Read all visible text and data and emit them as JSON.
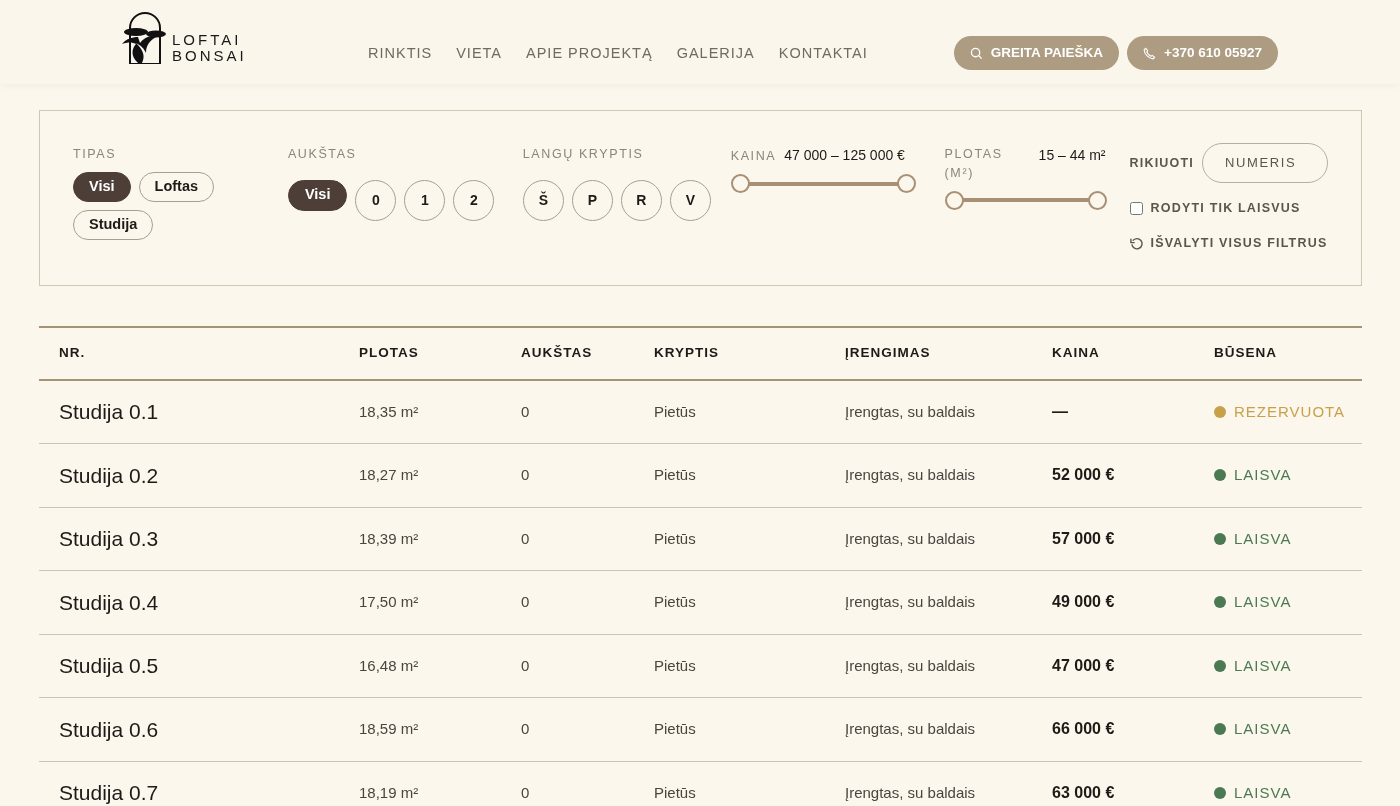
{
  "brand": {
    "line1": "LOFTAI",
    "line2": "BONSAI"
  },
  "nav": [
    "RINKTIS",
    "VIETA",
    "APIE PROJEKTĄ",
    "GALERIJA",
    "KONTAKTAI"
  ],
  "header_buttons": [
    {
      "kind": "search",
      "label": "GREITA PAIEŠKA"
    },
    {
      "kind": "phone",
      "label": "+370 610 05927"
    }
  ],
  "filters": {
    "type": {
      "label": "TIPAS",
      "options": [
        {
          "label": "Visi",
          "selected": true
        },
        {
          "label": "Loftas",
          "selected": false
        },
        {
          "label": "Studija",
          "selected": false
        }
      ]
    },
    "floor": {
      "label": "AUKŠTAS",
      "options": [
        {
          "label": "Visi",
          "selected": true
        },
        {
          "label": "0",
          "selected": false
        },
        {
          "label": "1",
          "selected": false
        },
        {
          "label": "2",
          "selected": false
        }
      ]
    },
    "direction": {
      "label": "LANGŲ KRYPTIS",
      "options": [
        {
          "label": "Š",
          "selected": false
        },
        {
          "label": "P",
          "selected": false
        },
        {
          "label": "R",
          "selected": false
        },
        {
          "label": "V",
          "selected": false
        }
      ]
    },
    "price": {
      "label": "KAINA",
      "reading": "47 000 – 125 000 €",
      "thumbs": [
        {
          "level": 0
        },
        {
          "level": 1
        }
      ]
    },
    "area": {
      "label": "PLOTAS (M²)",
      "reading": "15 – 44 m²",
      "thumbs": [
        {
          "level": 0
        },
        {
          "level": 1
        }
      ]
    },
    "sort": {
      "label": "RIKIUOTI",
      "value": "NUMERIS"
    },
    "only_free": {
      "label": "RODYTI TIK LAISVUS",
      "checked": false
    },
    "clear": {
      "label": "IŠVALYTI VISUS FILTRUS"
    }
  },
  "table": {
    "columns": [
      "NR.",
      "PLOTAS",
      "AUKŠTAS",
      "KRYPTIS",
      "ĮRENGIMAS",
      "KAINA",
      "BŪSENA"
    ],
    "rows": [
      {
        "name": "Studija 0.1",
        "area": "18,35 m²",
        "floor": "0",
        "direction": "Pietūs",
        "fit_out": "Įrengtas, su baldais",
        "price": "—",
        "status": "REZERVUOTA",
        "color": "#c9a04a"
      },
      {
        "name": "Studija 0.2",
        "area": "18,27 m²",
        "floor": "0",
        "direction": "Pietūs",
        "fit_out": "Įrengtas, su baldais",
        "price": "52 000 €",
        "status": "LAISVA",
        "color": "#4b7a52"
      },
      {
        "name": "Studija 0.3",
        "area": "18,39 m²",
        "floor": "0",
        "direction": "Pietūs",
        "fit_out": "Įrengtas, su baldais",
        "price": "57 000 €",
        "status": "LAISVA",
        "color": "#4b7a52"
      },
      {
        "name": "Studija 0.4",
        "area": "17,50 m²",
        "floor": "0",
        "direction": "Pietūs",
        "fit_out": "Įrengtas, su baldais",
        "price": "49 000 €",
        "status": "LAISVA",
        "color": "#4b7a52"
      },
      {
        "name": "Studija 0.5",
        "area": "16,48 m²",
        "floor": "0",
        "direction": "Pietūs",
        "fit_out": "Įrengtas, su baldais",
        "price": "47 000 €",
        "status": "LAISVA",
        "color": "#4b7a52"
      },
      {
        "name": "Studija 0.6",
        "area": "18,59 m²",
        "floor": "0",
        "direction": "Pietūs",
        "fit_out": "Įrengtas, su baldais",
        "price": "66 000 €",
        "status": "LAISVA",
        "color": "#4b7a52"
      },
      {
        "name": "Studija 0.7",
        "area": "18,19 m²",
        "floor": "0",
        "direction": "Pietūs",
        "fit_out": "Įrengtas, su baldais",
        "price": "63 000 €",
        "status": "LAISVA",
        "color": "#4b7a52"
      }
    ]
  }
}
